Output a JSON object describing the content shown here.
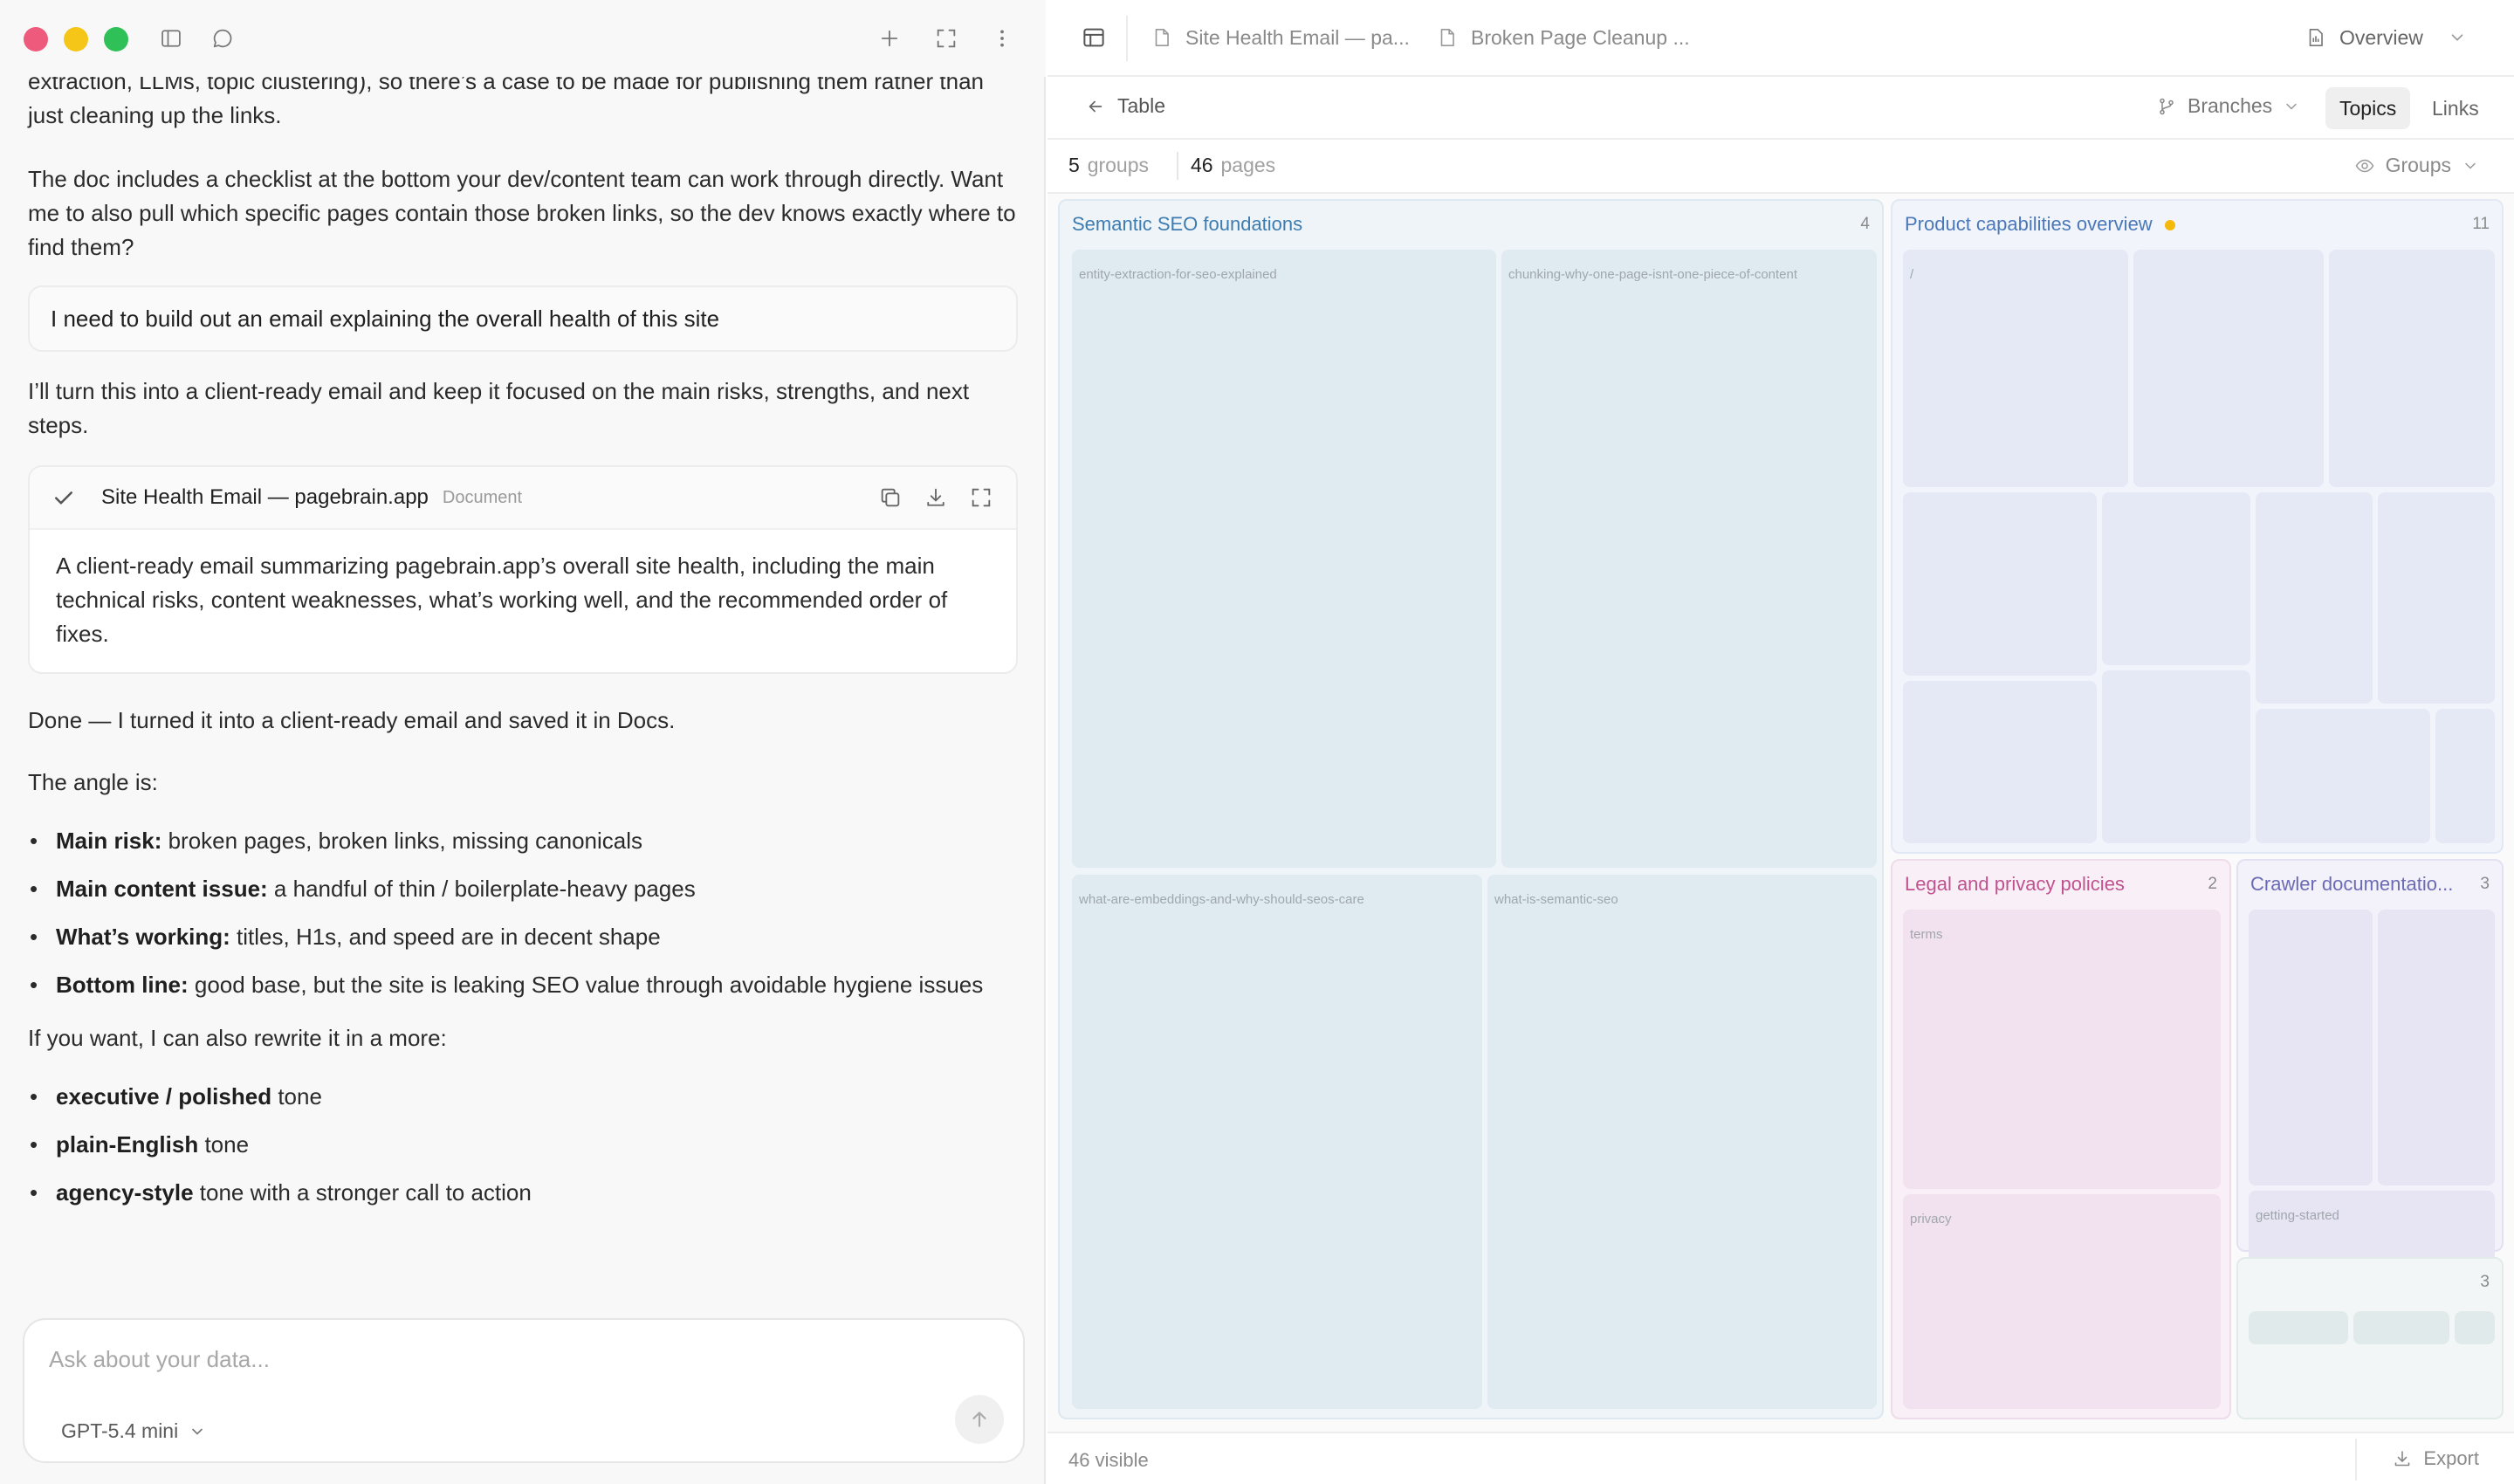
{
  "chat": {
    "para_top": "extraction, LLMs, topic clustering), so there’s a case to be made for publishing them rather than just cleaning up the links.",
    "para_checklist": "The doc includes a checklist at the bottom your dev/content team can work through directly. Want me to also pull which specific pages contain those broken links, so the dev knows exactly where to find them?",
    "user_message": "I need to build out an email explaining the overall health of this site",
    "assistant_intro": "I’ll turn this into a client-ready email and keep it focused on the main risks, strengths, and next steps.",
    "doc_card": {
      "title": "Site Health Email — pagebrain.app",
      "type": "Document",
      "summary": "A client-ready email summarizing pagebrain.app’s overall site health, including the main technical risks, content weaknesses, what’s working well, and the recommended order of fixes."
    },
    "done_text": "Done — I turned it into a client-ready email and saved it in Docs.",
    "angle_text": "The angle is:",
    "angle_items": [
      {
        "bold": "Main risk:",
        "text": " broken pages, broken links, missing canonicals"
      },
      {
        "bold": "Main content issue:",
        "text": " a handful of thin / boilerplate-heavy pages"
      },
      {
        "bold": "What’s working:",
        "text": " titles, H1s, and speed are in decent shape"
      },
      {
        "bold": "Bottom line:",
        "text": " good base, but the site is leaking SEO value through avoidable hygiene issues"
      }
    ],
    "rewrite_text": "If you want, I can also rewrite it in a more:",
    "tone_items": [
      {
        "bold": "executive / polished",
        "text": " tone"
      },
      {
        "bold": "plain-English",
        "text": " tone"
      },
      {
        "bold": "agency-style",
        "text": " tone with a stronger call to action"
      }
    ]
  },
  "composer": {
    "placeholder": "Ask about your data...",
    "model": "GPT-5.4 mini"
  },
  "right": {
    "tabs": [
      "Site Health Email — pa...",
      "Broken Page Cleanup ..."
    ],
    "overview_label": "Overview",
    "back_label": "Table",
    "branches_label": "Branches",
    "view_options": [
      "Topics",
      "Links"
    ],
    "active_view": "Topics",
    "stats": {
      "groups_count": "5",
      "groups_label": "groups",
      "pages_count": "46",
      "pages_label": "pages"
    },
    "groups_dropdown": "Groups",
    "footer_visible": "46 visible",
    "export_label": "Export"
  },
  "treemap": {
    "groups": [
      {
        "name": "Semantic SEO foundations",
        "count": "4",
        "pages": [
          "entity-extraction-for-seo-explained",
          "chunking-why-one-page-isnt-one-piece-of-content",
          "what-are-embeddings-and-why-should-seos-care",
          "what-is-semantic-seo"
        ]
      },
      {
        "name": "Product capabilities overview",
        "count": "11",
        "first_page": "/",
        "status_dot_color": "#f5b90a"
      },
      {
        "name": "Legal and privacy policies",
        "count": "2",
        "pages": [
          "terms",
          "privacy"
        ]
      },
      {
        "name": "Crawler documentatio...",
        "count": "3",
        "page": "getting-started"
      },
      {
        "name": "",
        "count": "3"
      }
    ]
  },
  "colors": {
    "accent_blue": "#3e7cb0",
    "legal_pink": "#c0528f",
    "crawler_purple": "#6b6bb5",
    "traffic_red": "#ee5a7b",
    "traffic_yellow": "#f5c518",
    "traffic_green": "#2fc058"
  }
}
